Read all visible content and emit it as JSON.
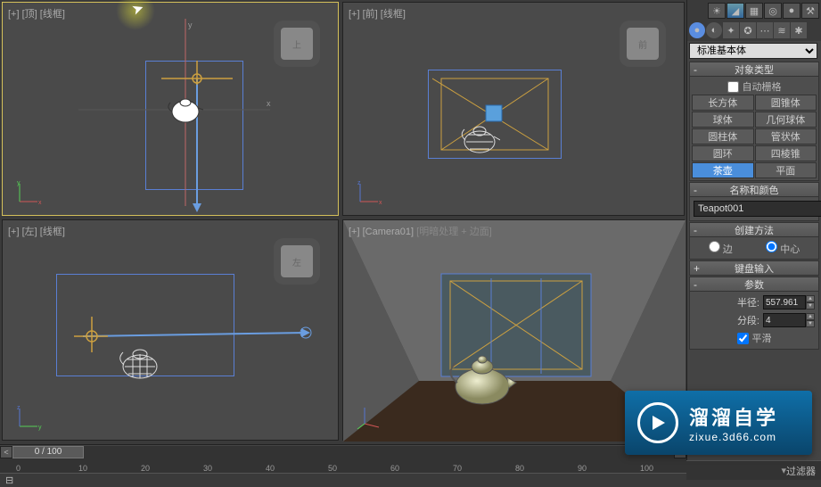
{
  "viewports": {
    "top": {
      "label": "[+] [顶] [线框]",
      "cube": "上"
    },
    "front": {
      "label": "[+] [前] [线框]",
      "cube": "前"
    },
    "left": {
      "label": "[+] [左] [线框]",
      "cube": "左"
    },
    "camera": {
      "label_prefix": "[+] [Camera01]",
      "label_suffix": "[明暗处理 + 边面]"
    }
  },
  "panel": {
    "dropdown": "标准基本体",
    "rollouts": {
      "objectType": {
        "title": "对象类型",
        "autogrid": "自动栅格"
      },
      "nameColor": {
        "title": "名称和颜色",
        "name": "Teapot001"
      },
      "method": {
        "title": "创建方法",
        "edge": "边",
        "center": "中心"
      },
      "keyboard": {
        "title": "键盘输入"
      },
      "params": {
        "title": "参数",
        "radius_label": "半径:",
        "radius_value": "557.961",
        "segments_label": "分段:",
        "segments_value": "4",
        "smooth": "平滑"
      }
    },
    "objects": [
      "长方体",
      "圆锥体",
      "球体",
      "几何球体",
      "圆柱体",
      "管状体",
      "圆环",
      "四棱锥",
      "茶壶",
      "平面"
    ]
  },
  "timeline": {
    "current": "0 / 100",
    "ticks": [
      "0",
      "10",
      "20",
      "30",
      "40",
      "50",
      "60",
      "70",
      "80",
      "90",
      "100"
    ]
  },
  "brand": {
    "cn": "溜溜自学",
    "en": "zixue.3d66.com"
  },
  "bottom": {
    "filter": "过滤器"
  }
}
